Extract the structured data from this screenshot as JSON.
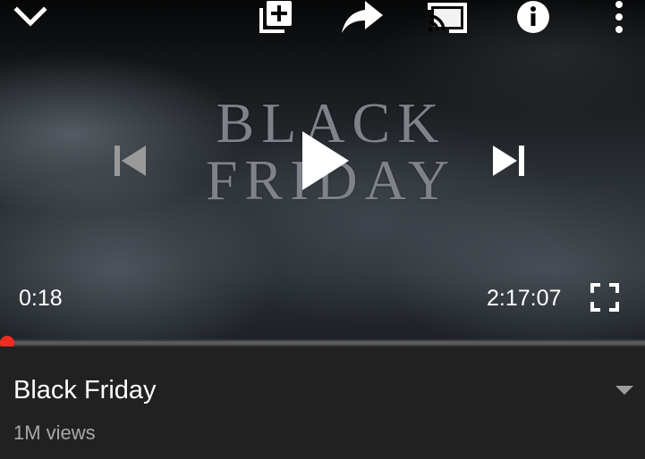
{
  "player": {
    "video_art_line1": "BLACK",
    "video_art_line2": "FRIDAY",
    "current_time": "0:18",
    "duration": "2:17:07",
    "progress_fraction": 0.0022
  },
  "top_bar": {
    "icons": [
      "collapse-chevron-icon",
      "add-to-playlist-icon",
      "share-icon",
      "cast-icon",
      "info-icon",
      "more-vert-icon"
    ]
  },
  "controls": {
    "icons": [
      "skip-previous-icon",
      "play-icon",
      "skip-next-icon",
      "fullscreen-icon"
    ]
  },
  "video": {
    "title": "Black Friday",
    "views": "1M views"
  },
  "colors": {
    "accent": "#f12b24",
    "background": "#212121",
    "text_primary": "#ffffff",
    "text_secondary": "#a8a8a8"
  }
}
